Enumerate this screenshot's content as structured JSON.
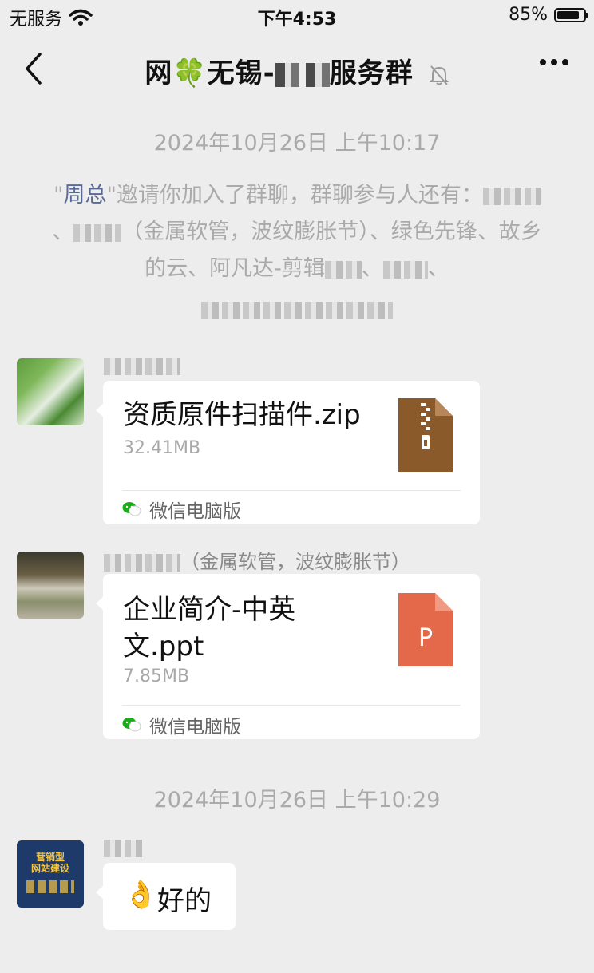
{
  "status_bar": {
    "carrier": "无服务",
    "time": "下午4:53",
    "battery": "85%",
    "battery_level": 0.85
  },
  "nav": {
    "title_prefix": "网🍀无锡-",
    "title_suffix": "服务群"
  },
  "messages": {
    "timestamp1": "2024年10月26日 上午10:17",
    "system": {
      "quote_open": "\"",
      "inviter": "周总",
      "quote_close": "\"",
      "text_before": "邀请你加入了群聊，群聊参与人还有：",
      "seg1": "、",
      "seg2": "（金属软管，波纹膨胀节）、绿色先锋、故乡的云、阿凡达-剪辑",
      "seg3": "、",
      "seg4": "、"
    },
    "file1": {
      "name": "资质原件扫描件.zip",
      "size": "32.41MB",
      "source": "微信电脑版",
      "icon": "zip-file-icon",
      "color": "#8b5a2b"
    },
    "file2": {
      "sender_suffix": "（金属软管，波纹膨胀节）",
      "name": "企业简介-中英文.ppt",
      "size": "7.85MB",
      "source": "微信电脑版",
      "icon": "ppt-file-icon",
      "icon_letter": "P",
      "color": "#e4684a"
    },
    "timestamp2": "2024年10月26日 上午10:29",
    "text3": {
      "emoji": "👌",
      "text": "好的"
    },
    "avatar3": {
      "line1": "营销型",
      "line2": "网站建设"
    }
  }
}
